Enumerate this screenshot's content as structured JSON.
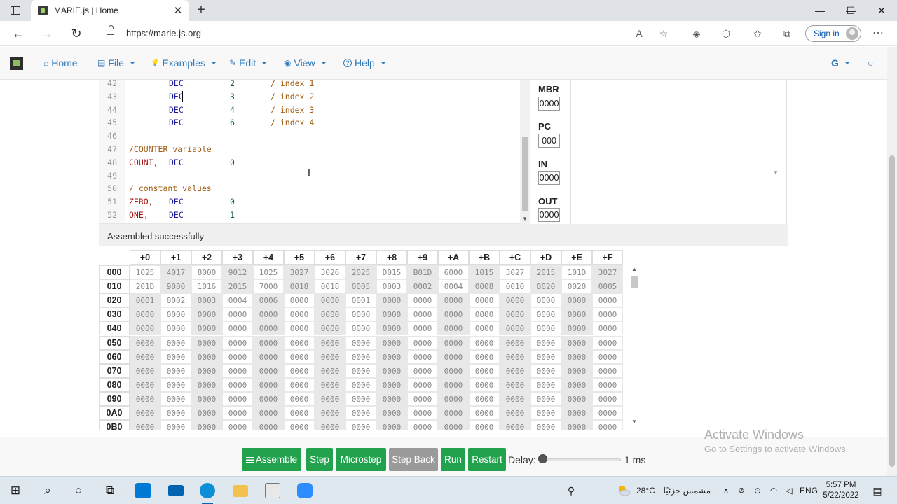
{
  "browser": {
    "tab_title": "MARIE.js | Home",
    "tab_close": "✕",
    "new_tab": "+",
    "url": "https://marie.js.org",
    "sign_in": "Sign in",
    "window_controls": {
      "minimize": "—",
      "maximize": "☐",
      "close": "✕"
    },
    "nav": {
      "back": "←",
      "forward": "→",
      "refresh": "↻"
    },
    "icons": [
      "read-aloud-icon",
      "favorite-add-icon",
      "browser-essentials-icon",
      "extensions-icon",
      "favorites-icon",
      "collections-icon"
    ],
    "icon_glyphs": {
      "read_aloud": "A",
      "favorite_add": "☆",
      "essentials": "◈",
      "extensions": "⬡",
      "favorites": "✩",
      "collections": "⧉",
      "more": "⋯"
    }
  },
  "navbar": {
    "items": [
      {
        "label": "Home",
        "glyph": "⌂"
      },
      {
        "label": "File",
        "glyph": "▤"
      },
      {
        "label": "Examples",
        "glyph": "💡"
      },
      {
        "label": "Edit",
        "glyph": "✎"
      },
      {
        "label": "View",
        "glyph": "◉"
      },
      {
        "label": "Help",
        "glyph": "?"
      }
    ],
    "right_menu": "G",
    "github_glyph": "○"
  },
  "editor": {
    "lines": [
      {
        "num": "42",
        "label": "",
        "op": "DEC",
        "val": "2",
        "comment": "/ index 1"
      },
      {
        "num": "43",
        "label": "",
        "op": "DEC",
        "val": "3",
        "comment": "/ index 2"
      },
      {
        "num": "44",
        "label": "",
        "op": "DEC",
        "val": "4",
        "comment": "/ index 3"
      },
      {
        "num": "45",
        "label": "",
        "op": "DEC",
        "val": "6",
        "comment": "/ index 4"
      },
      {
        "num": "46",
        "label": "",
        "op": "",
        "val": "",
        "comment": ""
      },
      {
        "num": "47",
        "label": "",
        "op": "",
        "val": "",
        "comment": "/COUNTER variable"
      },
      {
        "num": "48",
        "label": "COUNT,",
        "op": "DEC",
        "val": "0",
        "comment": ""
      },
      {
        "num": "49",
        "label": "",
        "op": "",
        "val": "",
        "comment": ""
      },
      {
        "num": "50",
        "label": "",
        "op": "",
        "val": "",
        "comment": "/ constant values"
      },
      {
        "num": "51",
        "label": "ZERO,",
        "op": "DEC",
        "val": "0",
        "comment": ""
      },
      {
        "num": "52",
        "label": "ONE,",
        "op": "DEC",
        "val": "1",
        "comment": ""
      }
    ]
  },
  "registers": [
    {
      "name": "MBR",
      "value": "0000"
    },
    {
      "name": "PC",
      "value": "000"
    },
    {
      "name": "IN",
      "value": "0000"
    },
    {
      "name": "OUT",
      "value": "0000"
    }
  ],
  "status": "Assembled successfully",
  "memory": {
    "columns": [
      "+0",
      "+1",
      "+2",
      "+3",
      "+4",
      "+5",
      "+6",
      "+7",
      "+8",
      "+9",
      "+A",
      "+B",
      "+C",
      "+D",
      "+E",
      "+F"
    ],
    "rows": [
      {
        "addr": "000",
        "cells": [
          "1025",
          "4017",
          "8000",
          "9012",
          "1025",
          "3027",
          "3026",
          "2025",
          "D015",
          "B01D",
          "6000",
          "1015",
          "3027",
          "2015",
          "101D",
          "3027"
        ]
      },
      {
        "addr": "010",
        "cells": [
          "201D",
          "9000",
          "1016",
          "2015",
          "7000",
          "0018",
          "0018",
          "0005",
          "0003",
          "0002",
          "0004",
          "0008",
          "0010",
          "0020",
          "0020",
          "0005"
        ]
      },
      {
        "addr": "020",
        "cells": [
          "0001",
          "0002",
          "0003",
          "0004",
          "0006",
          "0000",
          "0000",
          "0001",
          "0000",
          "0000",
          "0000",
          "0000",
          "0000",
          "0000",
          "0000",
          "0000"
        ]
      },
      {
        "addr": "030",
        "cells": [
          "0000",
          "0000",
          "0000",
          "0000",
          "0000",
          "0000",
          "0000",
          "0000",
          "0000",
          "0000",
          "0000",
          "0000",
          "0000",
          "0000",
          "0000",
          "0000"
        ]
      },
      {
        "addr": "040",
        "cells": [
          "0000",
          "0000",
          "0000",
          "0000",
          "0000",
          "0000",
          "0000",
          "0000",
          "0000",
          "0000",
          "0000",
          "0000",
          "0000",
          "0000",
          "0000",
          "0000"
        ]
      },
      {
        "addr": "050",
        "cells": [
          "0000",
          "0000",
          "0000",
          "0000",
          "0000",
          "0000",
          "0000",
          "0000",
          "0000",
          "0000",
          "0000",
          "0000",
          "0000",
          "0000",
          "0000",
          "0000"
        ]
      },
      {
        "addr": "060",
        "cells": [
          "0000",
          "0000",
          "0000",
          "0000",
          "0000",
          "0000",
          "0000",
          "0000",
          "0000",
          "0000",
          "0000",
          "0000",
          "0000",
          "0000",
          "0000",
          "0000"
        ]
      },
      {
        "addr": "070",
        "cells": [
          "0000",
          "0000",
          "0000",
          "0000",
          "0000",
          "0000",
          "0000",
          "0000",
          "0000",
          "0000",
          "0000",
          "0000",
          "0000",
          "0000",
          "0000",
          "0000"
        ]
      },
      {
        "addr": "080",
        "cells": [
          "0000",
          "0000",
          "0000",
          "0000",
          "0000",
          "0000",
          "0000",
          "0000",
          "0000",
          "0000",
          "0000",
          "0000",
          "0000",
          "0000",
          "0000",
          "0000"
        ]
      },
      {
        "addr": "090",
        "cells": [
          "0000",
          "0000",
          "0000",
          "0000",
          "0000",
          "0000",
          "0000",
          "0000",
          "0000",
          "0000",
          "0000",
          "0000",
          "0000",
          "0000",
          "0000",
          "0000"
        ]
      },
      {
        "addr": "0A0",
        "cells": [
          "0000",
          "0000",
          "0000",
          "0000",
          "0000",
          "0000",
          "0000",
          "0000",
          "0000",
          "0000",
          "0000",
          "0000",
          "0000",
          "0000",
          "0000",
          "0000"
        ]
      },
      {
        "addr": "0B0",
        "cells": [
          "0000",
          "0000",
          "0000",
          "0000",
          "0000",
          "0000",
          "0000",
          "0000",
          "0000",
          "0000",
          "0000",
          "0000",
          "0000",
          "0000",
          "0000",
          "0000"
        ]
      }
    ]
  },
  "controls": {
    "assemble": "Assemble",
    "step": "Step",
    "microstep": "Microstep",
    "step_back": "Step Back",
    "run": "Run",
    "restart": "Restart",
    "delay_label": "Delay:",
    "delay_value": "1 ms",
    "delay_fraction": 0.0
  },
  "watermark": {
    "title": "Activate Windows",
    "subtitle": "Go to Settings to activate Windows."
  },
  "taskbar": {
    "weather_temp": "28°C",
    "weather_text": "مشمس جزئيًا",
    "language": "ENG",
    "time": "5:57 PM",
    "date": "5/22/2022",
    "glyphs": {
      "start": "⊞",
      "search": "⌕",
      "cortana": "○",
      "task_view": "⧉",
      "up_arrow": "∧",
      "notification": "▤",
      "people": "⚲"
    },
    "colors": {
      "store": "#0078d4",
      "mail": "#0063b1",
      "edge": "#0c8fd6",
      "explorer": "#f2c14e",
      "app": "#e8e8e8",
      "zoom": "#2d8cff"
    }
  },
  "colors": {
    "brand_blue": "#337ab7",
    "button_green": "#23a24d",
    "button_grey": "#9a9a9a"
  }
}
